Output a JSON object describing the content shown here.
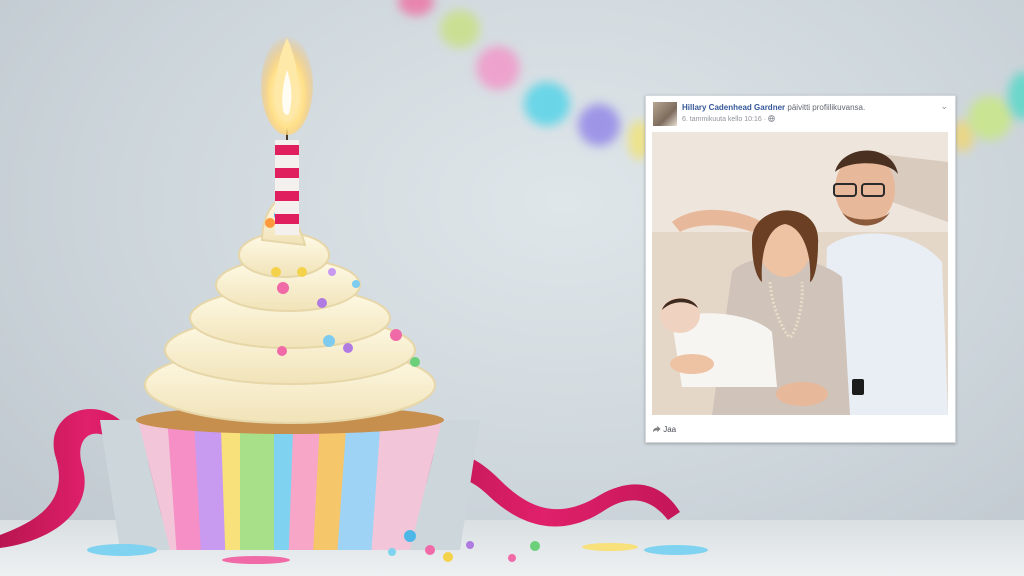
{
  "facebook_post": {
    "author_name": "Hillary Cadenhead Gardner",
    "action_text": "päivitti profiilikuvansa.",
    "timestamp": "6. tammikuuta kello 10:16 ·",
    "privacy_icon": "globe-icon",
    "menu_icon": "chevron-down-icon",
    "share_icon": "share-arrow-icon",
    "share_label": "Jaa"
  },
  "colors": {
    "facebook_link": "#365899",
    "ribbon": "#d81b60",
    "candle_flame": "#ffd36b"
  }
}
